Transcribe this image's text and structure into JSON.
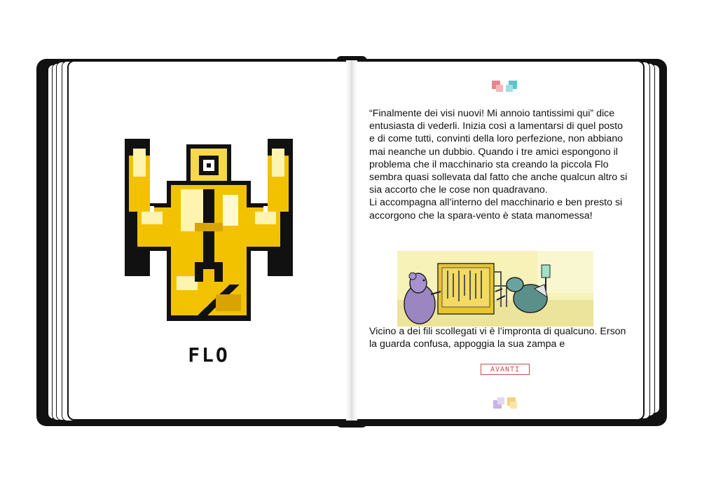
{
  "character": {
    "name": "FLO",
    "portrait_icon": "flo-pixel-portrait-icon"
  },
  "story": {
    "paragraph_1": "“Finalmente dei visi nuovi! Mi annoio tantissimi qui” dice entusiasta di vederli. Inizia così a lamentarsi di quel posto e di come tutti, convinti della loro perfezione, non abbiano mai neanche un dubbio. Quando i tre amici espongono il problema che il macchinario sta creando la piccola Flo sembra quasi sollevata dal fatto che anche qualcun altro si sia accorto che le cose non quadravano.",
    "paragraph_2": "Li accompagna all’interno del macchinario e ben presto si accorgono che la spara-vento è stata manomessa!",
    "paragraph_3": "Vicino a dei fili scollegati vi è l’impronta di qualcuno. Erson la guarda confusa, appoggia la sua zampa e"
  },
  "navigation": {
    "next_label": "AVANTI"
  },
  "colors": {
    "accent_red": "#c0504d",
    "gold": "#f2c200",
    "teal": "#5ec4c8",
    "pink": "#e8848c",
    "lilac": "#c9b3e6"
  }
}
